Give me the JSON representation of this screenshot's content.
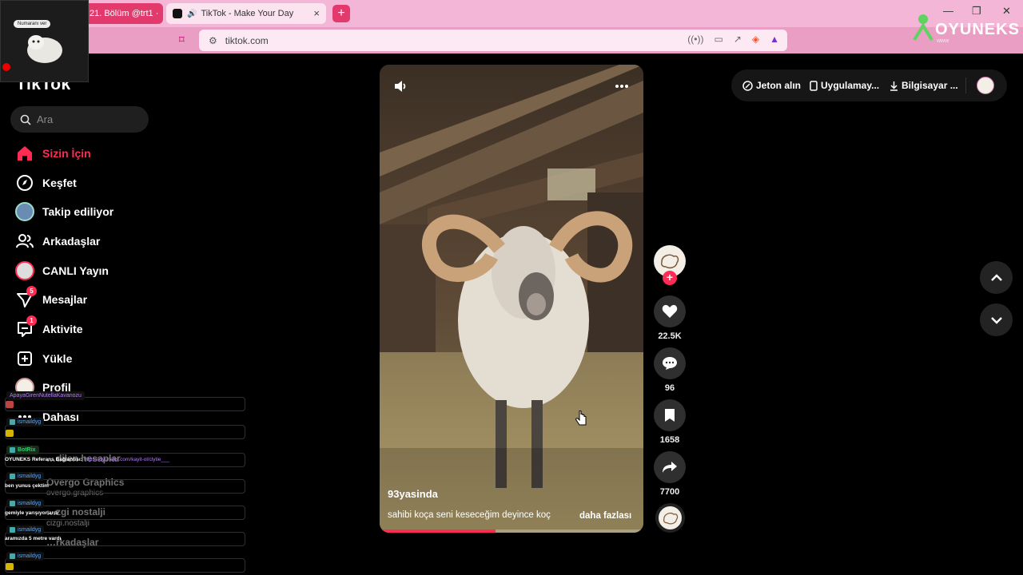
{
  "browser": {
    "tabs": [
      {
        "label": "21. Bölüm @trt1 ·"
      },
      {
        "label": "TikTok - Make Your Day"
      }
    ],
    "new_tab_label": "+",
    "url": "tiktok.com",
    "window_controls": {
      "minimize": "—",
      "restore": "❐",
      "close": "✕"
    }
  },
  "overlay": {
    "brand": "OYUNEKS",
    "brand_sub": "www",
    "webcam_bubble": "Numaranı ver"
  },
  "sidebar": {
    "logo": "TikTok",
    "search_placeholder": "Ara",
    "items": [
      {
        "label": "Sizin İçin",
        "icon": "home-icon",
        "active": true
      },
      {
        "label": "Keşfet",
        "icon": "compass-icon"
      },
      {
        "label": "Takip ediliyor",
        "icon": "following-avatar-icon"
      },
      {
        "label": "Arkadaşlar",
        "icon": "friends-icon"
      },
      {
        "label": "CANLI Yayın",
        "icon": "live-icon"
      },
      {
        "label": "Mesajlar",
        "icon": "messages-icon",
        "badge": "5"
      },
      {
        "label": "Aktivite",
        "icon": "activity-icon",
        "badge": "1"
      },
      {
        "label": "Yükle",
        "icon": "upload-icon"
      },
      {
        "label": "Profil",
        "icon": "profile-avatar-icon"
      },
      {
        "label": "Dahası",
        "icon": "more-icon"
      }
    ],
    "partial_following": [
      {
        "name": "…dilen hesaplar"
      },
      {
        "name": "Overgo Graphics",
        "handle": "overgo.graphics"
      },
      {
        "name": "…zgi nostalji",
        "handle": "cizgi.nostalji"
      },
      {
        "name": "…rkadaşlar"
      }
    ]
  },
  "chat": {
    "messages": [
      {
        "user": "ApayaGirenNutellaKavanozu",
        "text": ""
      },
      {
        "user": "ismaildyg",
        "text": ""
      },
      {
        "user": "BotRix",
        "text": "OYUNEKS Referans Bağlantısı: ",
        "link": "https://oyuneks.com/kayit-ol/clytie___"
      },
      {
        "user": "ismaildyg",
        "text": "ben yunus çektim"
      },
      {
        "user": "ismaildyg",
        "text": "gemiyle yarışıyorlardı"
      },
      {
        "user": "ismaildyg",
        "text": "aramızda 5 metre vardı"
      },
      {
        "user": "ismaildyg",
        "text": ""
      }
    ]
  },
  "video": {
    "title": "93yasinda",
    "description": "sahibi koça seni keseceğim deyince koç",
    "more_label": "daha fazlası",
    "progress": 0.44
  },
  "actions": {
    "likes": "22.5K",
    "comments": "96",
    "saves": "1658",
    "shares": "7700"
  },
  "header": {
    "coins": "Jeton alın",
    "app": "Uygulamay...",
    "desktop": "Bilgisayar ..."
  },
  "colors": {
    "accent": "#fe2c55",
    "tabbar": "#f3b6d6",
    "addressbar": "#ea9ec4"
  }
}
